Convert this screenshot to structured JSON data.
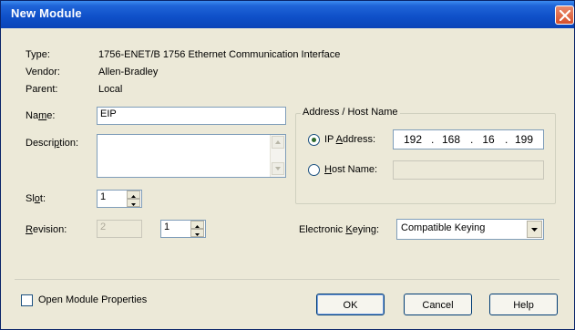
{
  "window": {
    "title": "New Module"
  },
  "info": {
    "type_label": "Type:",
    "type_value": "1756-ENET/B 1756 Ethernet Communication Interface",
    "vendor_label": "Vendor:",
    "vendor_value": "Allen-Bradley",
    "parent_label": "Parent:",
    "parent_value": "Local"
  },
  "name": {
    "label_pre": "Na",
    "label_hot": "m",
    "label_post": "e:",
    "value": "EIP"
  },
  "description": {
    "label_pre": "Descri",
    "label_hot": "p",
    "label_post": "tion:",
    "value": ""
  },
  "slot": {
    "label_pre": "Sl",
    "label_hot": "o",
    "label_post": "t:",
    "value": "1"
  },
  "revision": {
    "label_hot": "R",
    "label_post": "evision:",
    "major": "2",
    "minor": "1"
  },
  "address": {
    "group_title": "Address / Host Name",
    "ip_label_pre": "IP ",
    "ip_label_hot": "A",
    "ip_label_post": "ddress:",
    "ip_octets": [
      "192",
      "168",
      "16",
      "199"
    ],
    "ip_selected": true,
    "host_label_hot": "H",
    "host_label_post": "ost Name:",
    "host_value": ""
  },
  "keying": {
    "label_pre": "Electronic ",
    "label_hot": "K",
    "label_post": "eying:",
    "value": "Compatible Keying"
  },
  "open_props": {
    "label": "Open Module Properties",
    "checked": false
  },
  "buttons": {
    "ok": "OK",
    "cancel": "Cancel",
    "help": "Help"
  }
}
